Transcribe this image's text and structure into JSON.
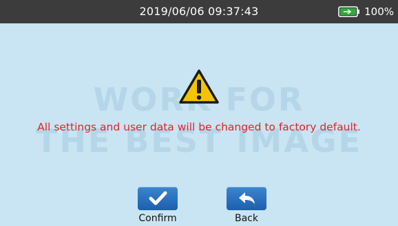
{
  "status_bar": {
    "datetime": "2019/06/06 09:37:43",
    "battery_percent_text": "100%",
    "battery_charging": true
  },
  "watermark": {
    "line1": "WORK FOR",
    "line2": "THE BEST IMAGE"
  },
  "dialog": {
    "icon": "warning-icon",
    "message": "All settings and user data will be changed to factory default."
  },
  "buttons": {
    "confirm": {
      "label": "Confirm",
      "icon": "check-icon"
    },
    "back": {
      "label": "Back",
      "icon": "back-arrow-icon"
    }
  },
  "colors": {
    "background": "#c9e4f2",
    "status_bar": "#3c3c3c",
    "message_text": "#e8202a",
    "button": "#2a72c0",
    "warning": "#f5c400"
  }
}
